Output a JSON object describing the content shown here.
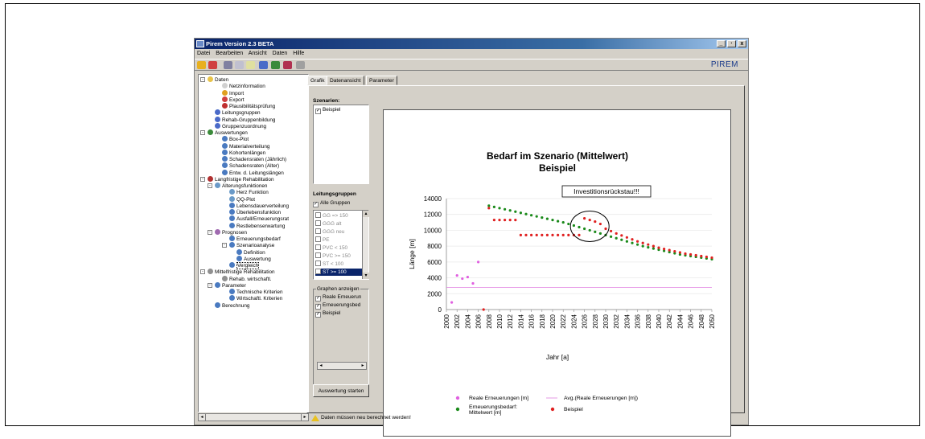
{
  "window": {
    "title": "Pirem Version 2.3 BETA",
    "controls": [
      "_",
      "·",
      "x"
    ]
  },
  "menu": [
    "Datei",
    "Bearbeiten",
    "Ansicht",
    "Daten",
    "Hilfe"
  ],
  "brand": "PIREM",
  "tree": [
    {
      "label": "Daten",
      "level": 0,
      "icon": "folder-icon",
      "color": "#e8c34a",
      "exp": "-"
    },
    {
      "label": "Netzinformation",
      "level": 2,
      "icon": "info-icon",
      "color": "#d0d0d0"
    },
    {
      "label": "Import",
      "level": 2,
      "icon": "import-icon",
      "color": "#e0a020"
    },
    {
      "label": "Export",
      "level": 2,
      "icon": "export-icon",
      "color": "#d04040"
    },
    {
      "label": "Plausibilitätsprüfung",
      "level": 2,
      "icon": "check-icon",
      "color": "#c03030"
    },
    {
      "label": "Leitungsgruppen",
      "level": 1,
      "icon": "pipe-icon",
      "color": "#4a6ac8"
    },
    {
      "label": "Rehab-Gruppenbildung",
      "level": 1,
      "icon": "pipe-icon",
      "color": "#4a6ac8"
    },
    {
      "label": "Gruppenzuordnung",
      "level": 1,
      "icon": "pipe-icon",
      "color": "#4a6ac8"
    },
    {
      "label": "Auswertungen",
      "level": 0,
      "icon": "chart-icon",
      "color": "#3a8a3a",
      "exp": "-"
    },
    {
      "label": "Box-Plot",
      "level": 2,
      "icon": "node-icon",
      "color": "#4a7ac0"
    },
    {
      "label": "Materialverteilung",
      "level": 2,
      "icon": "node-icon",
      "color": "#4a7ac0"
    },
    {
      "label": "Kohortenlängen",
      "level": 2,
      "icon": "node-icon",
      "color": "#4a7ac0"
    },
    {
      "label": "Schadensraten (Jährlich)",
      "level": 2,
      "icon": "node-icon",
      "color": "#4a7ac0"
    },
    {
      "label": "Schadensraten (Alter)",
      "level": 2,
      "icon": "node-icon",
      "color": "#4a7ac0"
    },
    {
      "label": "Entw. d. Leitungslängen",
      "level": 2,
      "icon": "node-icon",
      "color": "#4a7ac0"
    },
    {
      "label": "Langfristige Rehabilitation",
      "level": 0,
      "icon": "chart-icon",
      "color": "#b03030",
      "exp": "-"
    },
    {
      "label": "Alterungsfunktionen",
      "level": 1,
      "icon": "func-icon",
      "color": "#6a9ac8",
      "exp": "-"
    },
    {
      "label": "Herz Funktion",
      "level": 3,
      "icon": "func-icon",
      "color": "#6a9ac8"
    },
    {
      "label": "QQ-Plot",
      "level": 3,
      "icon": "func-icon",
      "color": "#6a9ac8"
    },
    {
      "label": "Lebensdauerverteilung",
      "level": 3,
      "icon": "node-icon",
      "color": "#4a7ac0"
    },
    {
      "label": "Überlebensfunktion",
      "level": 3,
      "icon": "node-icon",
      "color": "#4a7ac0"
    },
    {
      "label": "Ausfall/Erneuerungsrat",
      "level": 3,
      "icon": "node-icon",
      "color": "#4a7ac0"
    },
    {
      "label": "Restlebenserwartung",
      "level": 3,
      "icon": "node-icon",
      "color": "#4a7ac0"
    },
    {
      "label": "Prognosen",
      "level": 1,
      "icon": "table-icon",
      "color": "#a06ab0",
      "exp": "-"
    },
    {
      "label": "Erneuerungsbedarf",
      "level": 3,
      "icon": "node-icon",
      "color": "#4a7ac0"
    },
    {
      "label": "Szenarioanalyse",
      "level": 3,
      "icon": "node-icon",
      "color": "#4a7ac0",
      "exp": "-"
    },
    {
      "label": "Definition",
      "level": 4,
      "icon": "node-icon",
      "color": "#4a7ac0"
    },
    {
      "label": "Auswertung",
      "level": 4,
      "icon": "node-icon",
      "color": "#4a7ac0"
    },
    {
      "label": "Vergleich",
      "level": 3,
      "icon": "node-icon",
      "color": "#4a7ac0"
    },
    {
      "label": "Mittelfristige Rehabilitation",
      "level": 0,
      "icon": "doc-icon",
      "color": "#909090",
      "exp": "-"
    },
    {
      "label": "Rehab. wirtschaftl.",
      "level": 2,
      "icon": "doc-icon",
      "color": "#909090"
    },
    {
      "label": "Parameter",
      "level": 1,
      "icon": "node-icon",
      "color": "#4a7ac0",
      "exp": "-"
    },
    {
      "label": "Technische Kriterien",
      "level": 3,
      "icon": "node-icon",
      "color": "#4a7ac0"
    },
    {
      "label": "Wirtschaftl. Kriterien",
      "level": 3,
      "icon": "node-icon",
      "color": "#4a7ac0"
    },
    {
      "label": "Berechnung",
      "level": 1,
      "icon": "node-icon",
      "color": "#4a7ac0"
    }
  ],
  "tabs": [
    "Grafik",
    "Datenansicht",
    "Parameter"
  ],
  "scenarios": {
    "label": "Szenarien:",
    "items": [
      "Beispiel"
    ]
  },
  "groups": {
    "label": "Leitungsgruppen",
    "all": "Alle Gruppen",
    "items": [
      "GG => 150",
      "GGG alt",
      "GGG neu",
      "PE",
      "PVC < 150",
      "PVC >= 150",
      "ST < 100",
      "ST >= 100"
    ],
    "selected": 7
  },
  "graphs": {
    "label": "Graphen anzeigen",
    "items": [
      "Reale Erneuerun",
      "Erneuerungsbed",
      "Beispiel"
    ]
  },
  "start_button": "Auswertung starten",
  "status": "Daten müssen neu berechnet werden!",
  "chart_data": {
    "type": "scatter",
    "title": "Bedarf im Szenario (Mittelwert)",
    "subtitle": "Beispiel",
    "xlabel": "Jahr [a]",
    "ylabel": "Länge [m]",
    "xlim": [
      2000,
      2050
    ],
    "ylim": [
      0,
      14000
    ],
    "yticks": [
      0,
      2000,
      4000,
      6000,
      8000,
      10000,
      12000,
      14000
    ],
    "xticks": [
      2000,
      2002,
      2004,
      2006,
      2008,
      2010,
      2012,
      2014,
      2016,
      2018,
      2020,
      2022,
      2024,
      2026,
      2028,
      2030,
      2032,
      2034,
      2036,
      2038,
      2040,
      2042,
      2044,
      2046,
      2048,
      2050
    ],
    "annotation": "Investitionsrückstau!!!",
    "avg_value": 2800,
    "legend": [
      {
        "name": "Reale Erneuerungen [m]",
        "color": "#e060e0",
        "kind": "dot"
      },
      {
        "name": "Avg.(Reale Erneuerungen [m])",
        "color": "#e080e0",
        "kind": "line"
      },
      {
        "name": "Erneuerungsbedarf: Mittelwert [m]",
        "color": "#1a8a1a",
        "kind": "dot"
      },
      {
        "name": "Beispiel",
        "color": "#e02020",
        "kind": "dot"
      }
    ],
    "series": [
      {
        "name": "Reale Erneuerungen [m]",
        "color": "#e060e0",
        "x": [
          2001,
          2002,
          2003,
          2004,
          2005,
          2006
        ],
        "y": [
          900,
          4300,
          3900,
          4100,
          3300,
          6000
        ]
      },
      {
        "name": "Erneuerungsbedarf: Mittelwert [m]",
        "color": "#1a8a1a",
        "x": [
          2008,
          2009,
          2010,
          2011,
          2012,
          2013,
          2014,
          2015,
          2016,
          2017,
          2018,
          2019,
          2020,
          2021,
          2022,
          2023,
          2024,
          2025,
          2026,
          2027,
          2028,
          2029,
          2030,
          2031,
          2032,
          2033,
          2034,
          2035,
          2036,
          2037,
          2038,
          2039,
          2040,
          2041,
          2042,
          2043,
          2044,
          2045,
          2046,
          2047,
          2048,
          2049,
          2050
        ],
        "y": [
          13100,
          12950,
          12800,
          12650,
          12500,
          12350,
          12200,
          12050,
          11900,
          11750,
          11600,
          11450,
          11300,
          11150,
          11000,
          10800,
          10600,
          10400,
          10200,
          10000,
          9800,
          9600,
          9400,
          9200,
          9000,
          8800,
          8600,
          8400,
          8200,
          8000,
          7850,
          7700,
          7550,
          7400,
          7250,
          7100,
          6950,
          6850,
          6750,
          6650,
          6550,
          6450,
          6350
        ]
      },
      {
        "name": "Beispiel",
        "color": "#e02020",
        "x": [
          2007,
          2008,
          2009,
          2010,
          2011,
          2012,
          2013,
          2014,
          2015,
          2016,
          2017,
          2018,
          2019,
          2020,
          2021,
          2022,
          2023,
          2024,
          2025,
          2026,
          2027,
          2028,
          2029,
          2030,
          2031,
          2032,
          2033,
          2034,
          2035,
          2036,
          2037,
          2038,
          2039,
          2040,
          2041,
          2042,
          2043,
          2044,
          2045,
          2046,
          2047,
          2048,
          2049,
          2050
        ],
        "y": [
          0,
          12800,
          11300,
          11300,
          11300,
          11300,
          11300,
          9400,
          9400,
          9400,
          9400,
          9400,
          9400,
          9400,
          9400,
          9400,
          9400,
          9400,
          9400,
          11500,
          11300,
          11100,
          10800,
          10200,
          9900,
          9600,
          9350,
          9100,
          8850,
          8600,
          8400,
          8200,
          8000,
          7800,
          7650,
          7500,
          7350,
          7200,
          7050,
          6950,
          6850,
          6750,
          6650,
          6550
        ]
      }
    ]
  }
}
